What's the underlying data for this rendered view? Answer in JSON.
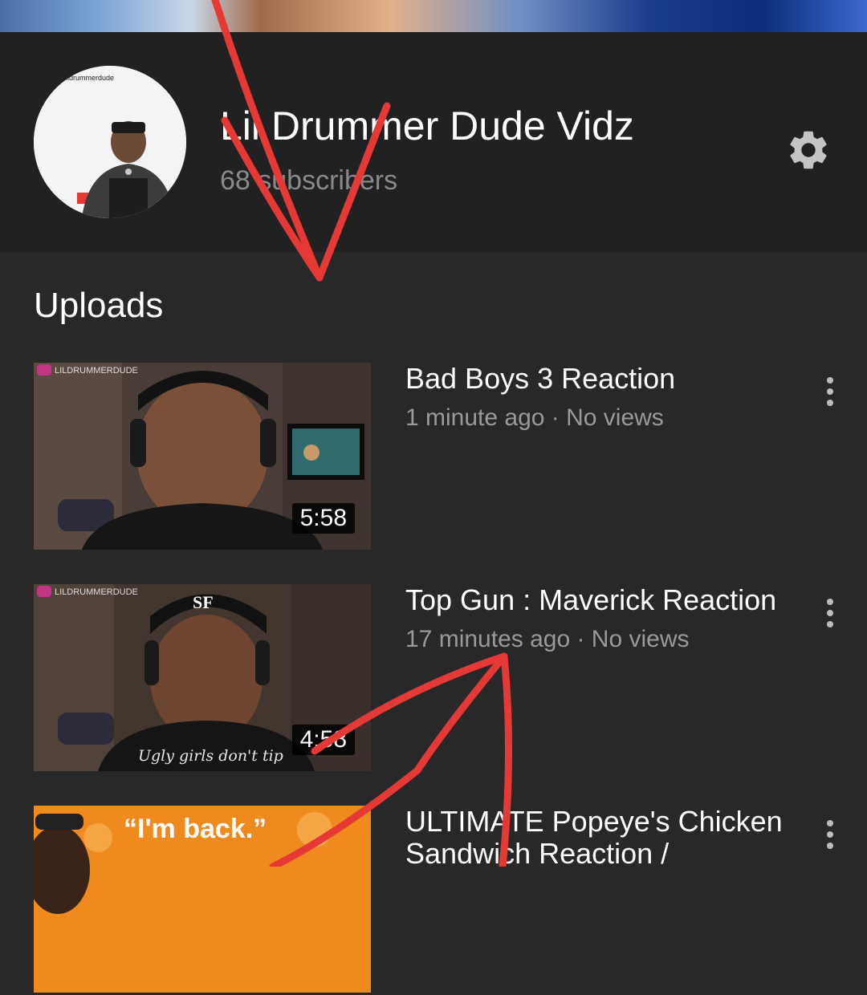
{
  "channel": {
    "name": "Lil Drummer Dude Vidz",
    "subscribers": "68 subscribers",
    "avatar_tag": "lildrummerdude"
  },
  "uploads": {
    "title": "Uploads",
    "videos": [
      {
        "title": "Bad Boys 3 Reaction",
        "meta": "1 minute ago · No views",
        "duration": "5:58",
        "overlay_handle": "LILDRUMMERDUDE"
      },
      {
        "title": "Top Gun : Maverick Reaction",
        "meta": "17 minutes ago · No views",
        "duration": "4:58",
        "overlay_handle": "LILDRUMMERDUDE",
        "shirt_text": "Ugly girls don't tip"
      },
      {
        "title": "ULTIMATE Popeye's Chicken Sandwich Reaction /",
        "thumb_text": "“I'm back.”"
      }
    ]
  },
  "colors": {
    "background": "#282828",
    "header": "#212121",
    "annotation": "#e53935"
  },
  "icons": [
    "gear-icon",
    "kebab-menu-icon"
  ]
}
